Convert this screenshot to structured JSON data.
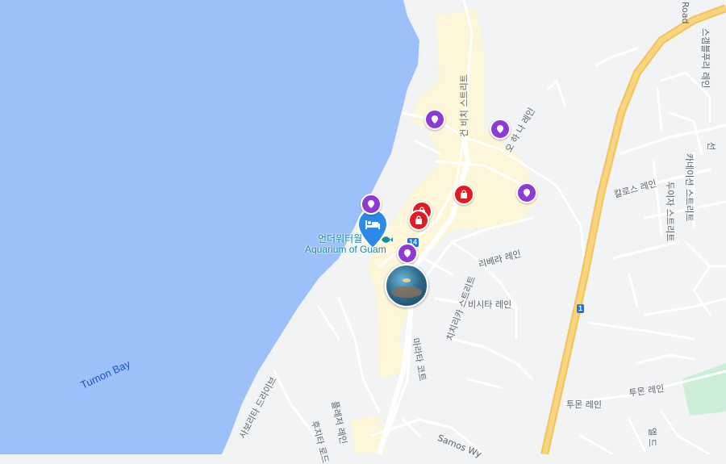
{
  "map": {
    "water_label": "Tumon Bay",
    "poi": {
      "name_ko": "언더워터월",
      "name_en": "Aquarium of Guam"
    },
    "route_shield": "14",
    "highway_shield": "1",
    "streets": {
      "road_top_right": "Road",
      "gun_beach": "건 비치 스트리트",
      "o_ha_na": "오 하 나 레인",
      "kalaros": "칼로스 레인",
      "ribera": "리베라 레인",
      "chichirika": "치치리카 스트리트",
      "bisita": "비시타 레인",
      "marata": "마라타 코트",
      "tumon": "투몬 레인",
      "tumon2": "투몬 레인",
      "sabori": "사보리타 드라이브",
      "pleja": "플레저 레인",
      "hujita": "후지타 로드",
      "samos": "Samos Wy",
      "kaneisin": "카네이션 스트리트",
      "duiza": "두이자 스트리트",
      "sgbr": "스갬블푸리 레인",
      "ll_right": "선",
      "el_right": "엘 드"
    },
    "markers": [
      {
        "kind": "attraction",
        "color": "#8e3ad4",
        "icon": "pin-icon"
      },
      {
        "kind": "attraction",
        "color": "#8e3ad4",
        "icon": "pin-icon"
      },
      {
        "kind": "attraction",
        "color": "#8e3ad4",
        "icon": "pin-icon"
      },
      {
        "kind": "attraction",
        "color": "#8e3ad4",
        "icon": "pin-icon"
      },
      {
        "kind": "attraction",
        "color": "#8e3ad4",
        "icon": "pin-icon"
      },
      {
        "kind": "shopping",
        "color": "#e21b23",
        "icon": "shopping-bag-icon"
      },
      {
        "kind": "shopping",
        "color": "#e21b23",
        "icon": "shopping-bag-icon"
      },
      {
        "kind": "shopping",
        "color": "#e21b23",
        "icon": "shopping-bag-icon"
      }
    ],
    "colors": {
      "water": "#9cc0f9",
      "land": "#f1f3f4",
      "road": "#ffffff",
      "highway": "#f8c967",
      "commercial": "#fdf6d8",
      "park": "#cdeed6",
      "hotel_pin": "#2b8ae8"
    }
  }
}
